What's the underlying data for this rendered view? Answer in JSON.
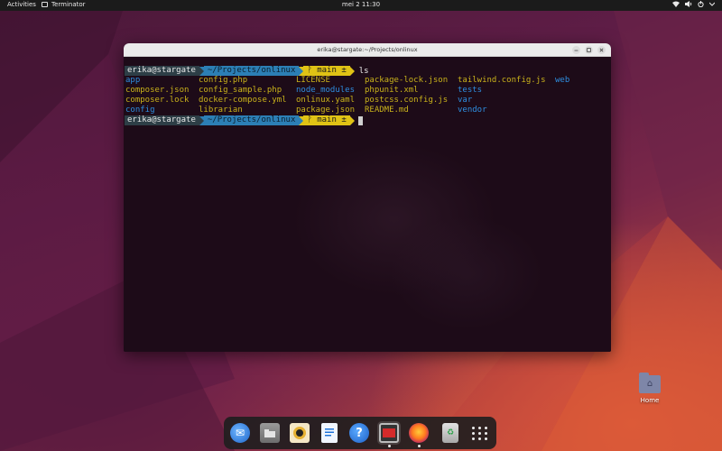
{
  "topbar": {
    "activities": "Activities",
    "app_name": "Terminator",
    "clock": "mei 2  11:30",
    "tray": [
      "network-icon",
      "volume-icon",
      "power-icon"
    ]
  },
  "window": {
    "title": "erika@stargate:~/Projects/onlinux",
    "buttons": [
      "minimize",
      "maximize",
      "close"
    ]
  },
  "terminal": {
    "prompt": {
      "user": "erika@stargate",
      "path": "~/Projects/onlinux",
      "git": "ᚹ main ±"
    },
    "command": "ls",
    "listing": [
      [
        {
          "name": "app",
          "type": "dir"
        },
        {
          "name": "composer.json",
          "type": "file"
        },
        {
          "name": "composer.lock",
          "type": "file"
        },
        {
          "name": "config",
          "type": "dir"
        }
      ],
      [
        {
          "name": "config.php",
          "type": "file"
        },
        {
          "name": "config_sample.php",
          "type": "file"
        },
        {
          "name": "docker-compose.yml",
          "type": "file"
        },
        {
          "name": "librarian",
          "type": "file"
        }
      ],
      [
        {
          "name": "LICENSE",
          "type": "file"
        },
        {
          "name": "node_modules",
          "type": "dir"
        },
        {
          "name": "onlinux.yaml",
          "type": "file"
        },
        {
          "name": "package.json",
          "type": "file"
        }
      ],
      [
        {
          "name": "package-lock.json",
          "type": "file"
        },
        {
          "name": "phpunit.xml",
          "type": "file"
        },
        {
          "name": "postcss.config.js",
          "type": "file"
        },
        {
          "name": "README.md",
          "type": "file"
        }
      ],
      [
        {
          "name": "tailwind.config.js",
          "type": "file"
        },
        {
          "name": "tests",
          "type": "dir"
        },
        {
          "name": "var",
          "type": "dir"
        },
        {
          "name": "vendor",
          "type": "dir"
        }
      ],
      [
        {
          "name": "web",
          "type": "dir"
        }
      ]
    ]
  },
  "desktop": {
    "home_label": "Home"
  },
  "dock": {
    "items": [
      "thunderbird-icon",
      "files-icon",
      "rhythmbox-icon",
      "writer-icon",
      "help-icon",
      "terminator-icon",
      "firefox-icon",
      "trash-icon",
      "show-apps-icon"
    ],
    "help_glyph": "?"
  }
}
